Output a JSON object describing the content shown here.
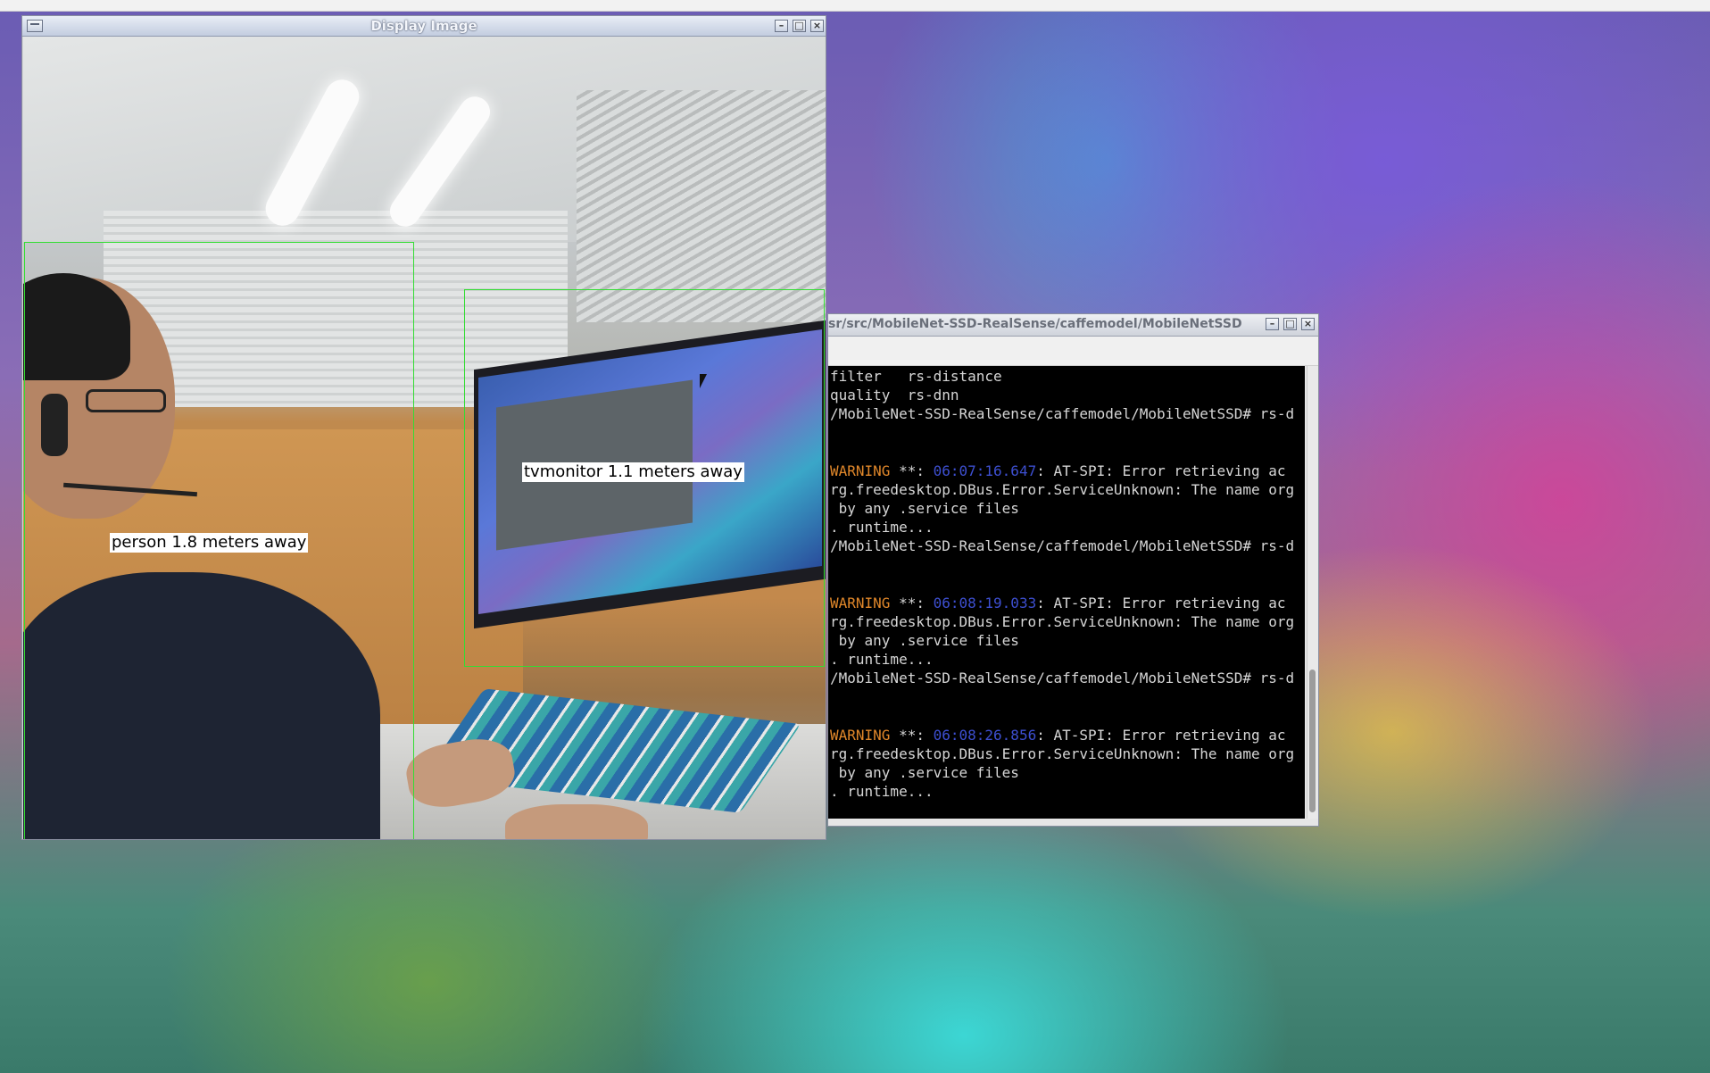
{
  "display_window": {
    "title": "Display Image",
    "controls": [
      "minimize",
      "maximize",
      "close"
    ],
    "detections": [
      {
        "label": "person 1.8 meters away"
      },
      {
        "label": "tvmonitor 1.1 meters away"
      }
    ]
  },
  "terminal_window": {
    "title": "sr/src/MobileNet-SSD-RealSense/caffemodel/MobileNetSSD",
    "controls": [
      "minimize",
      "maximize",
      "close"
    ],
    "lines": {
      "l1": "filter   rs-distance",
      "l2": "quality  rs-dnn",
      "l3": "/MobileNet-SSD-RealSense/caffemodel/MobileNetSSD# rs-d",
      "w1_warn": "WARNING",
      "w1_mid": " **: ",
      "w1_ts": "06:07:16.647",
      "w1_rest": ": AT-SPI: Error retrieving ac",
      "w1_l2": "rg.freedesktop.DBus.Error.ServiceUnknown: The name org",
      "w1_l3": " by any .service files",
      "w1_l4": ". runtime...",
      "l4": "/MobileNet-SSD-RealSense/caffemodel/MobileNetSSD# rs-d",
      "w2_warn": "WARNING",
      "w2_mid": " **: ",
      "w2_ts": "06:08:19.033",
      "w2_rest": ": AT-SPI: Error retrieving ac",
      "w2_l2": "rg.freedesktop.DBus.Error.ServiceUnknown: The name org",
      "w2_l3": " by any .service files",
      "w2_l4": ". runtime...",
      "l5": "/MobileNet-SSD-RealSense/caffemodel/MobileNetSSD# rs-d",
      "w3_warn": "WARNING",
      "w3_mid": " **: ",
      "w3_ts": "06:08:26.856",
      "w3_rest": ": AT-SPI: Error retrieving ac",
      "w3_l2": "rg.freedesktop.DBus.Error.ServiceUnknown: The name org",
      "w3_l3": " by any .service files",
      "w3_l4": ". runtime..."
    }
  },
  "colors": {
    "bbox": "#33dd33",
    "warning": "#e0872a",
    "timestamp": "#3d4fd0"
  },
  "icons": {
    "window_menu": "window-menu-icon",
    "minimize": "minimize-icon",
    "maximize": "maximize-icon",
    "close": "close-icon",
    "cursor": "mouse-cursor-icon"
  }
}
